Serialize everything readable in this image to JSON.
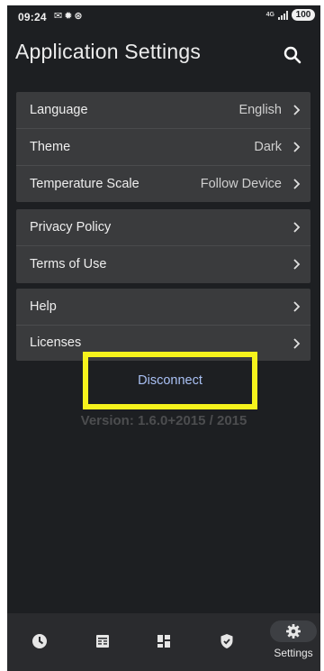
{
  "status_bar": {
    "time": "09:24",
    "network": "4G",
    "battery": "100"
  },
  "header": {
    "title": "Application Settings"
  },
  "groups": [
    {
      "rows": [
        {
          "label": "Language",
          "value": "English"
        },
        {
          "label": "Theme",
          "value": "Dark"
        },
        {
          "label": "Temperature Scale",
          "value": "Follow Device"
        }
      ]
    },
    {
      "rows": [
        {
          "label": "Privacy Policy"
        },
        {
          "label": "Terms of Use"
        }
      ]
    },
    {
      "rows": [
        {
          "label": "Help"
        },
        {
          "label": "Licenses"
        }
      ]
    }
  ],
  "disconnect": {
    "label": "Disconnect"
  },
  "version": {
    "text": "Version: 1.6.0+2015 / 2015"
  },
  "bottom_nav": {
    "items": [
      {
        "icon": "clock-icon"
      },
      {
        "icon": "calendar-icon"
      },
      {
        "icon": "dashboard-icon"
      },
      {
        "icon": "shield-icon"
      },
      {
        "icon": "gear-icon",
        "label": "Settings",
        "active": true
      }
    ]
  },
  "colors": {
    "background": "#1d1f22",
    "card": "#3a3b3d",
    "accent": "#a9c0f4",
    "highlight": "#f6f31c"
  }
}
